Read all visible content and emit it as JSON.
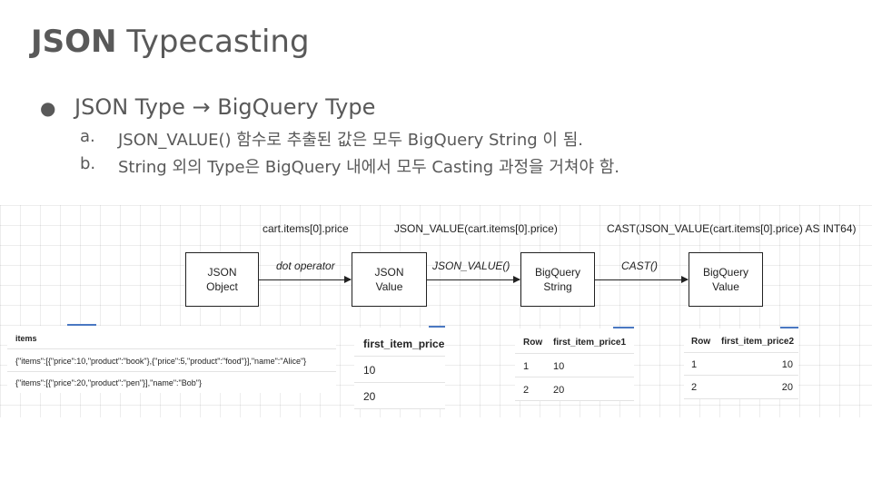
{
  "title": {
    "bold": "JSON",
    "rest": "Typecasting"
  },
  "bullets": {
    "main_marker": "●",
    "main": "JSON Type → BigQuery Type",
    "sub": [
      {
        "label": "a.",
        "text": "JSON_VALUE() 함수로 추출된 값은 모두 BigQuery String 이 됨."
      },
      {
        "label": "b.",
        "text": "String 외의 Type은  BigQuery 내에서 모두 Casting 과정을 거쳐야 함."
      }
    ]
  },
  "diagram": {
    "top_labels": [
      "cart.items[0].price",
      "JSON_VALUE(cart.items[0].price)",
      "CAST(JSON_VALUE(cart.items[0].price) AS INT64)"
    ],
    "arrow_labels": [
      "dot operator",
      "JSON_VALUE()",
      "CAST()"
    ],
    "boxes": [
      {
        "line1": "JSON",
        "line2": "Object"
      },
      {
        "line1": "JSON",
        "line2": "Value"
      },
      {
        "line1": "BigQuery",
        "line2": "String"
      },
      {
        "line1": "BigQuery",
        "line2": "Value"
      }
    ]
  },
  "tables": {
    "items": {
      "header": "items",
      "rows": [
        "{\"items\":[{\"price\":10,\"product\":\"book\"},{\"price\":5,\"product\":\"food\"}],\"name\":\"Alice\"}",
        "{\"items\":[{\"price\":20,\"product\":\"pen\"}],\"name\":\"Bob\"}"
      ]
    },
    "first_item_price": {
      "header": "first_item_price",
      "rows": [
        "10",
        "20"
      ]
    },
    "first_item_price1": {
      "headers": [
        "Row",
        "first_item_price1"
      ],
      "rows": [
        [
          "1",
          "10"
        ],
        [
          "2",
          "20"
        ]
      ]
    },
    "first_item_price2": {
      "headers": [
        "Row",
        "first_item_price2"
      ],
      "rows": [
        [
          "1",
          "10"
        ],
        [
          "2",
          "20"
        ]
      ]
    }
  },
  "colors": {
    "text": "#595959",
    "accent_line": "#4a78c2"
  }
}
